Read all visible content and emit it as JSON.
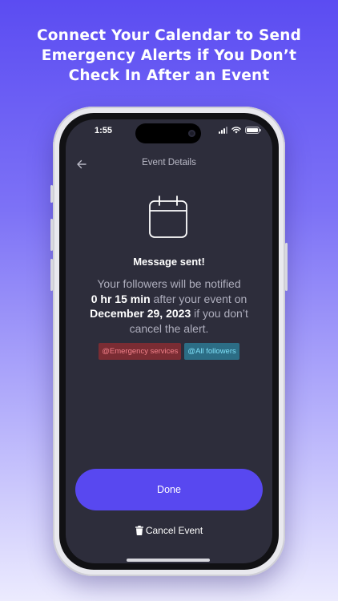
{
  "headline": [
    "Connect Your Calendar to Send",
    "Emergency Alerts if You Don’t",
    "Check In After an Event"
  ],
  "status_bar": {
    "time": "1:55"
  },
  "nav": {
    "title": "Event Details"
  },
  "message": {
    "title": "Message sent!",
    "line1": "Your followers will be notified",
    "duration": "0 hr 15 min",
    "after_text": " after your event on",
    "date": "December 29, 2023",
    "suffix": " if you don’t",
    "line4": "cancel the alert."
  },
  "tags": [
    {
      "label": "@Emergency services",
      "color": "#7a2c33"
    },
    {
      "label": "@All followers",
      "color": "#2c6d85"
    }
  ],
  "actions": {
    "done_label": "Done",
    "cancel_label": "Cancel Event"
  },
  "colors": {
    "accent": "#5848f0",
    "screen_bg": "#2d2d3b"
  }
}
